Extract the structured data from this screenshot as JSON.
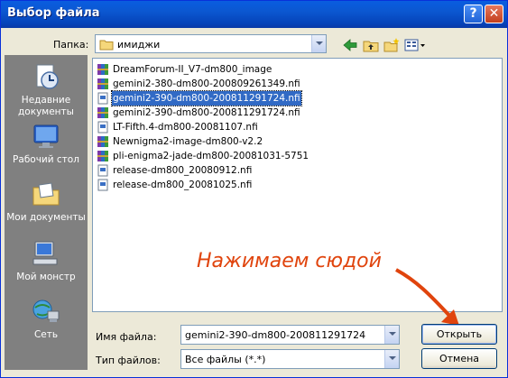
{
  "window": {
    "title": "Выбор файла"
  },
  "titlebar_buttons": {
    "help": "?",
    "close": "✕"
  },
  "look_in": {
    "label": "Папка:",
    "value": "имиджи"
  },
  "places": [
    {
      "label": "Недавние документы",
      "icon": "recent-documents-icon"
    },
    {
      "label": "Рабочий стол",
      "icon": "desktop-icon"
    },
    {
      "label": "Мои документы",
      "icon": "my-documents-icon"
    },
    {
      "label": "Мой монстр",
      "icon": "my-computer-icon"
    },
    {
      "label": "Сеть",
      "icon": "network-icon"
    }
  ],
  "files": [
    {
      "name": "DreamForum-II_V7-dm800_image",
      "type": "archive"
    },
    {
      "name": "gemini2-380-dm800-200809261349.nfi",
      "type": "archive"
    },
    {
      "name": "gemini2-390-dm800-200811291724.nfi",
      "type": "nfi",
      "selected": true
    },
    {
      "name": "gemini2-390-dm800-200811291724.nfi",
      "type": "archive"
    },
    {
      "name": "LT-Fifth.4-dm800-20081107.nfi",
      "type": "nfi"
    },
    {
      "name": "Newnigma2-image-dm800-v2.2",
      "type": "archive"
    },
    {
      "name": "pli-enigma2-jade-dm800-20081031-5751",
      "type": "archive"
    },
    {
      "name": "release-dm800_20080912.nfi",
      "type": "nfi"
    },
    {
      "name": "release-dm800_20081025.nfi",
      "type": "nfi"
    }
  ],
  "filename": {
    "label": "Имя файла:",
    "value": "gemini2-390-dm800-200811291724"
  },
  "filetype": {
    "label": "Тип файлов:",
    "value": "Все файлы (*.*)"
  },
  "buttons": {
    "open": "Открыть",
    "cancel": "Отмена"
  },
  "annotation": {
    "text": "Нажимаем сюдой",
    "color": "#e0440d"
  }
}
